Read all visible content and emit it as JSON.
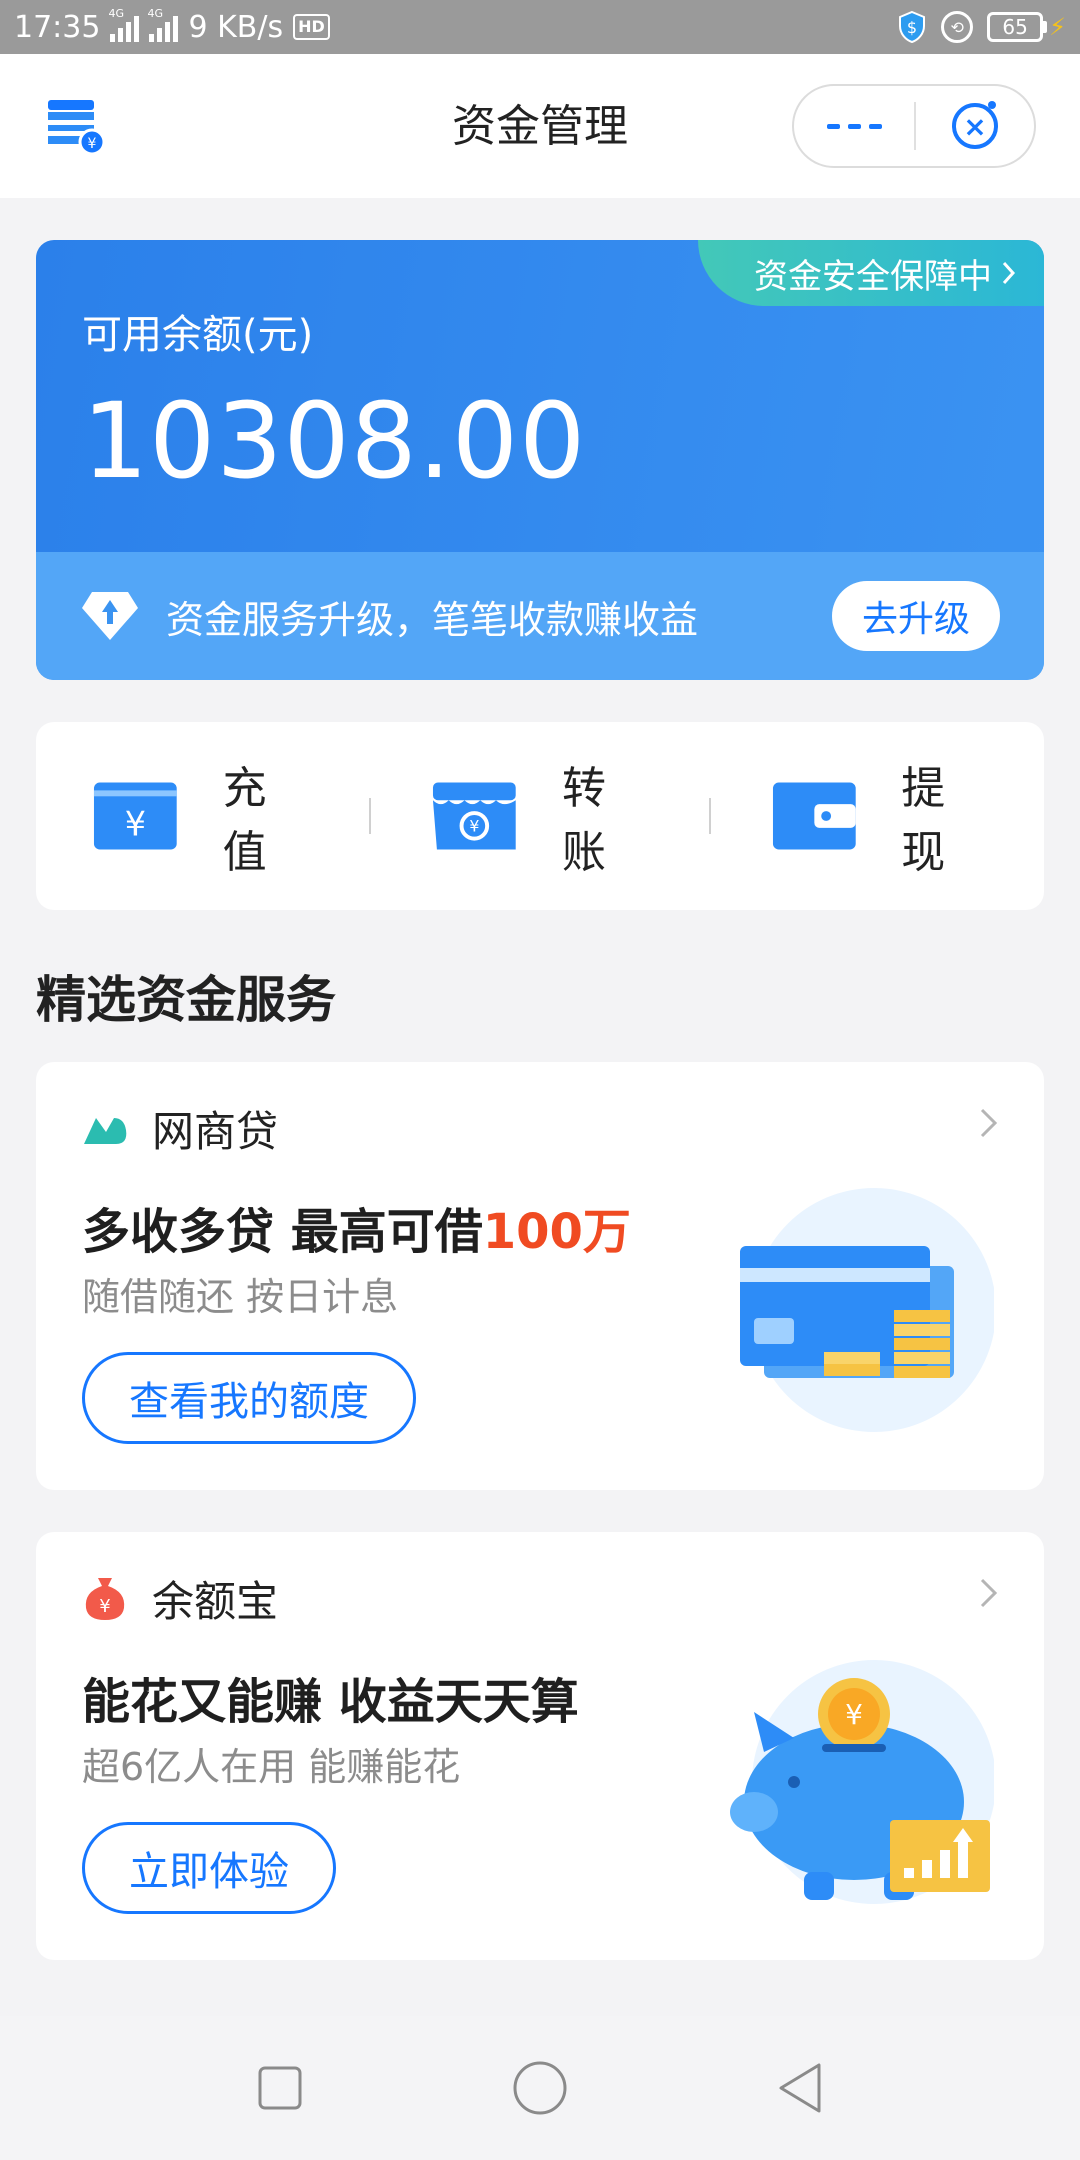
{
  "status_bar": {
    "time": "17:35",
    "net_tag_1": "4G",
    "net_tag_2": "4G",
    "speed": "9 KB/s",
    "hd": "HD",
    "battery": "65"
  },
  "nav": {
    "title": "资金管理"
  },
  "balance": {
    "label": "可用余额(元)",
    "value": "10308.00",
    "security_badge": "资金安全保障中",
    "upgrade_text": "资金服务升级，笔笔收款赚收益",
    "upgrade_button": "去升级"
  },
  "actions": [
    {
      "label": "充值",
      "icon": "recharge-icon"
    },
    {
      "label": "转账",
      "icon": "transfer-icon"
    },
    {
      "label": "提现",
      "icon": "withdraw-icon"
    }
  ],
  "section_title": "精选资金服务",
  "services": [
    {
      "name": "网商贷",
      "logo": "mybank-loan-logo",
      "headline_prefix": "多收多贷 最高可借",
      "headline_highlight": "100万",
      "subtitle": "随借随还 按日计息",
      "button": "查看我的额度",
      "illustration": "bank-card-coins-illustration"
    },
    {
      "name": "余额宝",
      "logo": "yuebao-logo",
      "headline_prefix": "能花又能赚 收益天天算",
      "headline_highlight": "",
      "subtitle": "超6亿人在用 能赚能花",
      "button": "立即体验",
      "illustration": "piggy-bank-illustration"
    }
  ],
  "colors": {
    "primary": "#1677ff",
    "card_gradient_start": "#2b80ea",
    "highlight": "#f04b22",
    "badge": "#3cc3c4"
  }
}
